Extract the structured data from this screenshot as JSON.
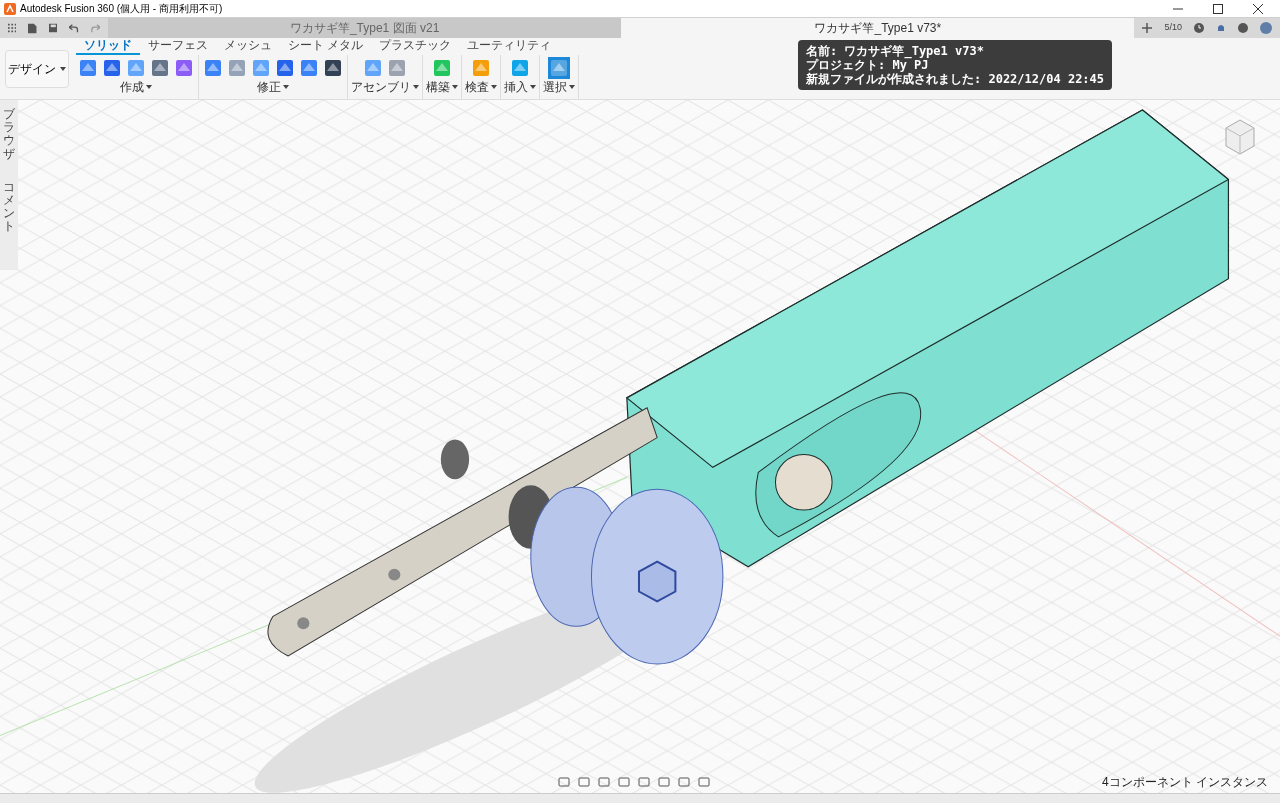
{
  "window": {
    "title": "Autodesk Fusion 360 (個人用 - 商用利用不可)"
  },
  "tabs": [
    {
      "label": "ワカサギ竿_Type1 図面 v21",
      "selected": false
    },
    {
      "label": "ワカサギ竿_Type1 v73*",
      "selected": true
    }
  ],
  "job_status": "5/10",
  "tooltip": [
    "名前: ワカサギ竿_Type1 v73*",
    "プロジェクト: My PJ",
    "新規ファイルが作成されました: 2022/12/04 22:45"
  ],
  "workspace": "デザイン",
  "ribbon_tabs": [
    {
      "label": "ソリッド",
      "selected": true
    },
    {
      "label": "サーフェス",
      "selected": false
    },
    {
      "label": "メッシュ",
      "selected": false
    },
    {
      "label": "シート メタル",
      "selected": false
    },
    {
      "label": "プラスチック",
      "selected": false
    },
    {
      "label": "ユーティリティ",
      "selected": false
    }
  ],
  "ribbon_groups": [
    "作成",
    "修正",
    "アセンブリ",
    "構築",
    "検査",
    "挿入",
    "選択"
  ],
  "side_panels": [
    "ブラウザ",
    "コメント"
  ],
  "status": "4コンポーネント インスタンス"
}
